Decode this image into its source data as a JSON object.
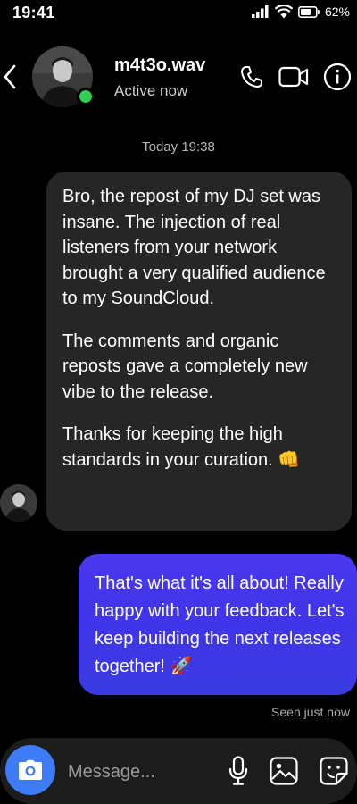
{
  "status_bar": {
    "time": "19:41",
    "battery": "62%"
  },
  "header": {
    "contact_name": "m4t3o.wav",
    "contact_status": "Active now",
    "online_color": "#2fcf4f",
    "icons": [
      "chevron-left-icon",
      "phone-icon",
      "video-camera-icon",
      "info-icon"
    ]
  },
  "conversation": {
    "timestamp": "Today 19:38",
    "incoming": {
      "paragraphs": [
        "Bro, the repost of my DJ set was insane. The injection of real listeners from your network brought a very qualified audience to my SoundCloud.",
        "The comments and organic reposts gave a completely new vibe to the release.",
        "Thanks for keeping the high standards in your curation. 👊"
      ]
    },
    "outgoing": {
      "text": "That's what it's all about! Really happy with your feedback. Let's keep building the next releases together! 🚀",
      "bubble_color": "#4338e8"
    },
    "seen_status": "Seen just now"
  },
  "composer": {
    "placeholder": "Message...",
    "camera_color": "#3e7bf7",
    "icons": [
      "camera-icon",
      "microphone-icon",
      "image-icon",
      "sticker-icon"
    ]
  }
}
